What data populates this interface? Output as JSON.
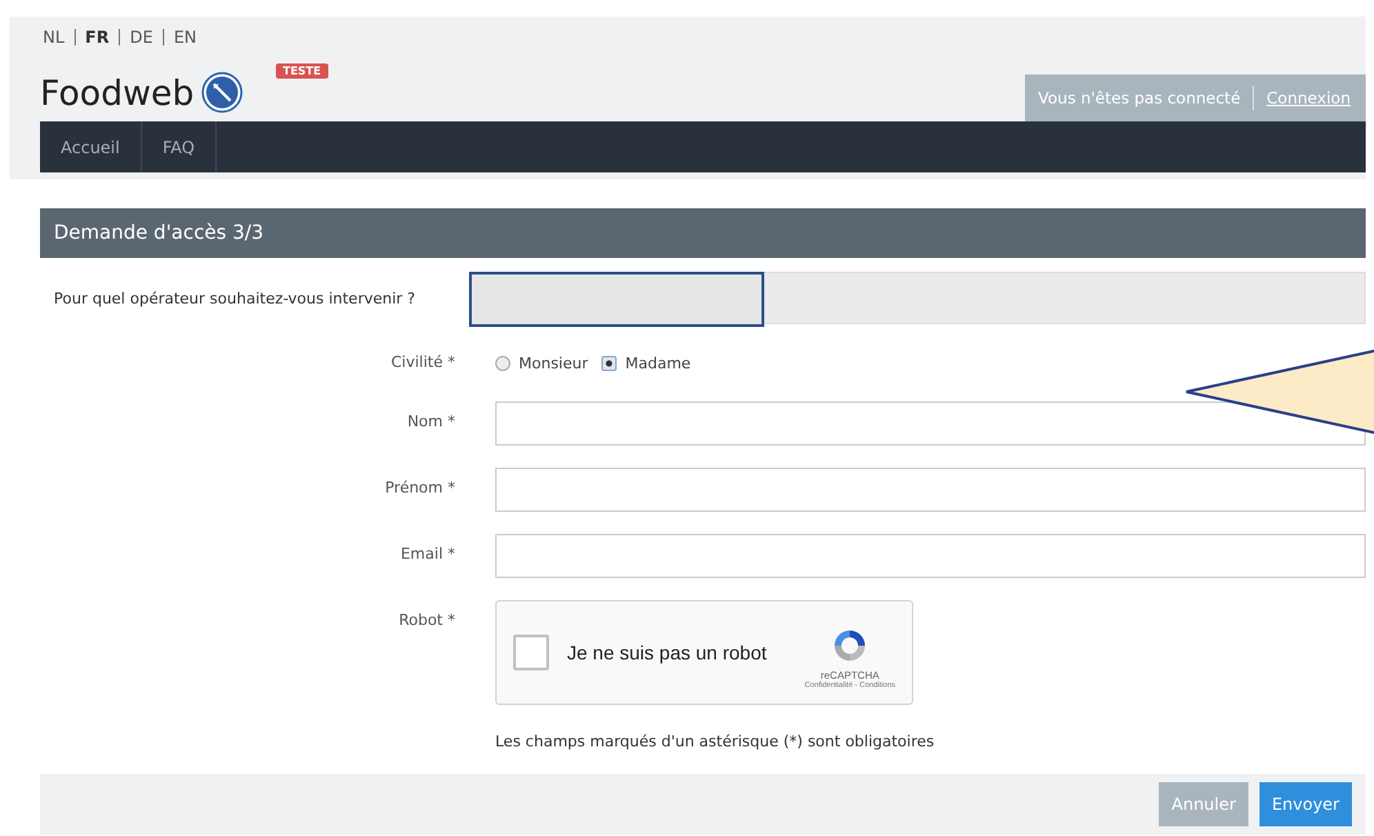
{
  "languages": [
    {
      "label": "NL",
      "selected": false
    },
    {
      "label": "FR",
      "selected": true
    },
    {
      "label": "DE",
      "selected": false
    },
    {
      "label": "EN",
      "selected": false
    }
  ],
  "logo": {
    "text": "Foodweb",
    "badge": "TESTE"
  },
  "user_bar": {
    "status": "Vous n'êtes pas connecté",
    "link": "Connexion"
  },
  "nav": [
    {
      "label": "Accueil"
    },
    {
      "label": "FAQ"
    }
  ],
  "panel": {
    "title": "Demande d'accès 3/3"
  },
  "operator": {
    "label": "Pour quel opérateur souhaitez-vous intervenir ?"
  },
  "civility": {
    "label": "Civilité *",
    "options": [
      {
        "label": "Monsieur",
        "selected": false
      },
      {
        "label": "Madame",
        "selected": true
      }
    ]
  },
  "fields": [
    {
      "label": "Nom *"
    },
    {
      "label": "Prénom *"
    },
    {
      "label": "Email *"
    }
  ],
  "robot": {
    "label": "Robot *",
    "checkbox_label": "Je ne suis pas un robot",
    "checked": false,
    "brand": "reCAPTCHA",
    "links": "Confidentialité - Conditions"
  },
  "note": "Les champs marqués d'un astérisque (*) sont obligatoires",
  "buttons": [
    {
      "label": "Annuler",
      "kind": "secondary"
    },
    {
      "label": "Envoyer",
      "kind": "primary"
    }
  ]
}
